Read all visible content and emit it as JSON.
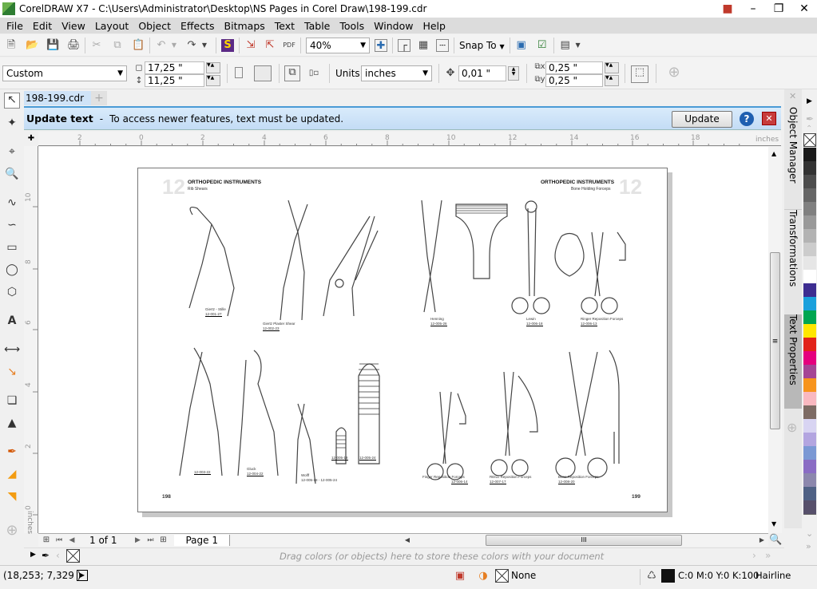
{
  "window": {
    "title": "CorelDRAW X7 - C:\\Users\\Administrator\\Desktop\\NS Pages in Corel Draw\\198-199.cdr",
    "controls": [
      "minimize",
      "restore",
      "close"
    ]
  },
  "menu": [
    "File",
    "Edit",
    "View",
    "Layout",
    "Object",
    "Effects",
    "Bitmaps",
    "Text",
    "Table",
    "Tools",
    "Window",
    "Help"
  ],
  "standard_toolbar": {
    "zoom_level": "40%",
    "snap_to_label": "Snap To"
  },
  "property_bar": {
    "page_preset": "Custom",
    "page_width": "17,25 \"",
    "page_height": "11,25 \"",
    "units_label": "Units:",
    "units_value": "inches",
    "nudge": "0,01 \"",
    "dup_x": "0,25 \"",
    "dup_y": "0,25 \""
  },
  "document_tab": {
    "name": "198-199.cdr"
  },
  "infobar": {
    "title": "Update text",
    "separator": "-",
    "message": "To access newer features, text must be updated.",
    "update_button": "Update"
  },
  "rulers": {
    "units": "inches",
    "h_ticks": [
      "2",
      "0",
      "2",
      "4",
      "6",
      "8",
      "10",
      "12",
      "14",
      "16",
      "18"
    ],
    "v_ticks": [
      "10",
      "8",
      "6",
      "4",
      "2",
      "0"
    ],
    "v_units": "inches"
  },
  "page_content": {
    "left_header_num": "12",
    "left_header_title": "ORTHOPEDIC INSTRUMENTS",
    "left_header_sub": "Rib Shears",
    "right_header_num": "12",
    "right_header_title": "ORTHOPEDIC INSTRUMENTS",
    "right_header_sub": "Bone Holding Forceps",
    "left_page_number": "198",
    "right_page_number": "199",
    "captions": [
      {
        "name": "Giertz - Stille",
        "code": "12-001-27"
      },
      {
        "name": "Giertz Plaster Shear",
        "code": "12-002-23"
      },
      {
        "name": "Henning",
        "code": "12-005-26"
      },
      {
        "name": "Lewin",
        "code": "12-006-18"
      },
      {
        "name": "Ringer Reposition Forceps",
        "code": "12-006-13"
      },
      {
        "name": "",
        "code": "12-003-22"
      },
      {
        "name": "Gluck",
        "code": "12-004-22"
      },
      {
        "name": "Wolff",
        "code": "12-005-18 - 12-005-24"
      },
      {
        "name": "",
        "code": "12-005-18"
      },
      {
        "name": "",
        "code": "12-005-24"
      },
      {
        "name": "Finger Reposition Forceps",
        "code": "12-006-14"
      },
      {
        "name": "REILL Reposition Forceps",
        "code": "12-007-17"
      },
      {
        "name": "Bone Reposition Forceps",
        "code": "12-008-20"
      }
    ]
  },
  "dockers": [
    "Object Manager",
    "Transformations",
    "Text Properties"
  ],
  "palette": [
    "#1a1a1a",
    "#333333",
    "#4d4d4d",
    "#666666",
    "#808080",
    "#999999",
    "#b3b3b3",
    "#cccccc",
    "#e6e6e6",
    "#ffffff",
    "#3d2d91",
    "#1aa0dc",
    "#00a651",
    "#ffe600",
    "#e2231a",
    "#e5007e",
    "#a54595",
    "#f7941d",
    "#f9b8c0",
    "#7d6b64",
    "#d8d4f2",
    "#b3a5e0",
    "#7b98d4",
    "#8a6cc4",
    "#8c87ad",
    "#4f6185",
    "#57506b"
  ],
  "page_nav": {
    "counter": "1 of 1",
    "page_tab": "Page 1"
  },
  "color_well": {
    "hint": "Drag colors (or objects) here to store these colors with your document"
  },
  "status": {
    "coords": "(18,253; 7,329 )",
    "fill_label": "None",
    "outline_color": "C:0 M:0 Y:0 K:100",
    "outline_width": "Hairline"
  }
}
